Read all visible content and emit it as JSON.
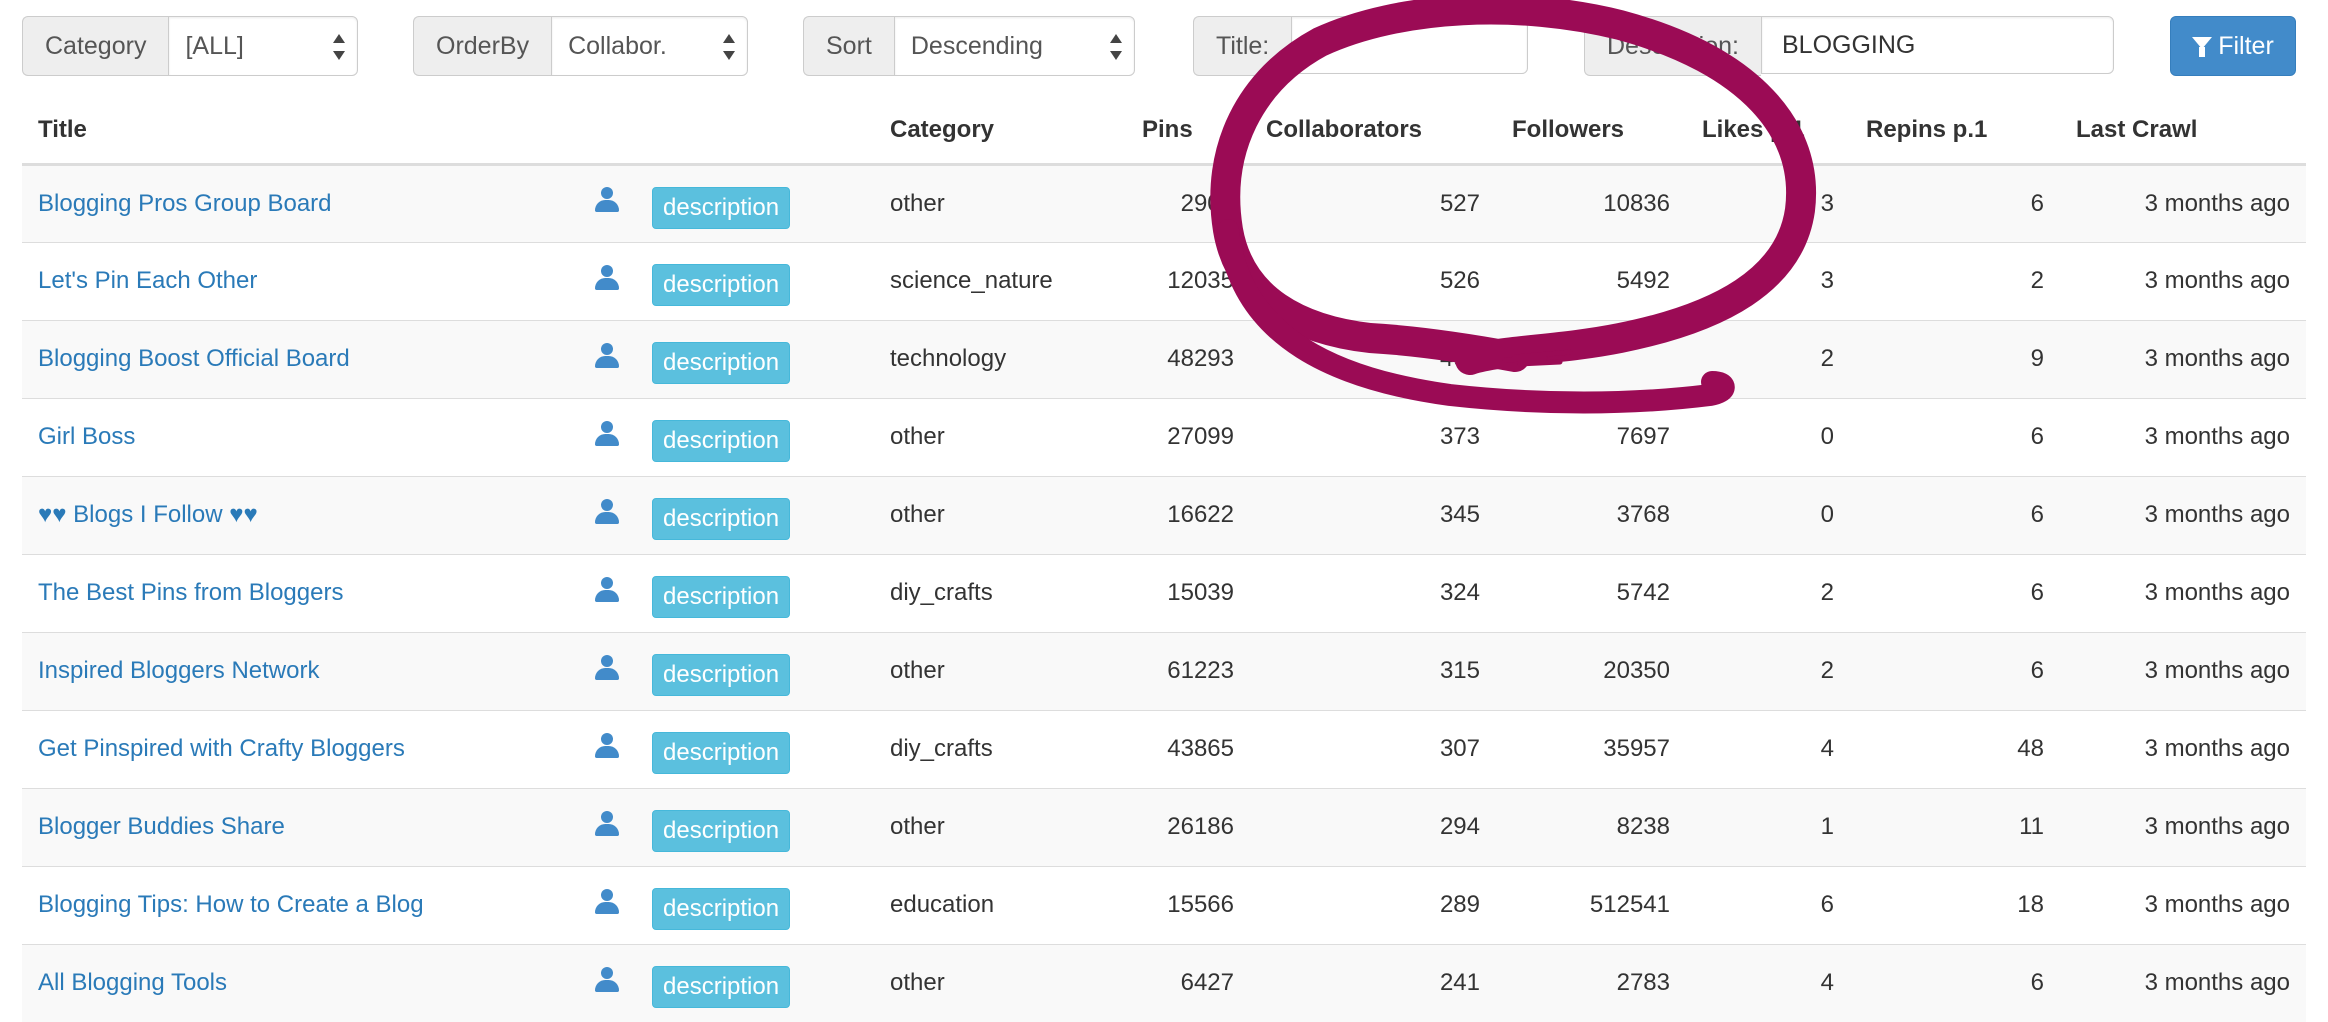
{
  "filters": {
    "category": {
      "label": "Category",
      "value": "[ALL]"
    },
    "orderby": {
      "label": "OrderBy",
      "value": "Collabor."
    },
    "sort": {
      "label": "Sort",
      "value": "Descending"
    },
    "title": {
      "label": "Title:",
      "value": ""
    },
    "description": {
      "label": "Description:",
      "value": "BLOGGING"
    },
    "filter_button": "Filter"
  },
  "table": {
    "headers": {
      "title": "Title",
      "category": "Category",
      "pins": "Pins",
      "collaborators": "Collaborators",
      "followers": "Followers",
      "likes": "Likes p.1",
      "repins": "Repins p.1",
      "last_crawl": "Last Crawl"
    },
    "description_label": "description",
    "rows": [
      {
        "title": "Blogging Pros Group Board",
        "category": "other",
        "pins": "2900",
        "collaborators": "527",
        "followers": "10836",
        "likes": "3",
        "repins": "6",
        "last_crawl": "3 months ago"
      },
      {
        "title": "Let's Pin Each Other",
        "category": "science_nature",
        "pins": "12035",
        "collaborators": "526",
        "followers": "5492",
        "likes": "3",
        "repins": "2",
        "last_crawl": "3 months ago"
      },
      {
        "title": "Blogging Boost Official Board",
        "category": "technology",
        "pins": "48293",
        "collaborators": "495",
        "followers": "",
        "likes": "2",
        "repins": "9",
        "last_crawl": "3 months ago"
      },
      {
        "title": "Girl Boss",
        "category": "other",
        "pins": "27099",
        "collaborators": "373",
        "followers": "7697",
        "likes": "0",
        "repins": "6",
        "last_crawl": "3 months ago"
      },
      {
        "title": "♥♥ Blogs I Follow ♥♥",
        "category": "other",
        "pins": "16622",
        "collaborators": "345",
        "followers": "3768",
        "likes": "0",
        "repins": "6",
        "last_crawl": "3 months ago"
      },
      {
        "title": "The Best Pins from Bloggers",
        "category": "diy_crafts",
        "pins": "15039",
        "collaborators": "324",
        "followers": "5742",
        "likes": "2",
        "repins": "6",
        "last_crawl": "3 months ago"
      },
      {
        "title": "Inspired Bloggers Network",
        "category": "other",
        "pins": "61223",
        "collaborators": "315",
        "followers": "20350",
        "likes": "2",
        "repins": "6",
        "last_crawl": "3 months ago"
      },
      {
        "title": "Get Pinspired with Crafty Bloggers",
        "category": "diy_crafts",
        "pins": "43865",
        "collaborators": "307",
        "followers": "35957",
        "likes": "4",
        "repins": "48",
        "last_crawl": "3 months ago"
      },
      {
        "title": "Blogger Buddies Share",
        "category": "other",
        "pins": "26186",
        "collaborators": "294",
        "followers": "8238",
        "likes": "1",
        "repins": "11",
        "last_crawl": "3 months ago"
      },
      {
        "title": "Blogging Tips: How to Create a Blog",
        "category": "education",
        "pins": "15566",
        "collaborators": "289",
        "followers": "512541",
        "likes": "6",
        "repins": "18",
        "last_crawl": "3 months ago"
      },
      {
        "title": "All Blogging Tools",
        "category": "other",
        "pins": "6427",
        "collaborators": "241",
        "followers": "2783",
        "likes": "4",
        "repins": "6",
        "last_crawl": "3 months ago"
      }
    ]
  },
  "colors": {
    "link": "#2a7ab8",
    "primary_button": "#428bca",
    "info_button": "#5bc0de",
    "annotation": "#9b0b55"
  },
  "icons": {
    "user": "user-icon",
    "filter": "filter-icon",
    "select_arrows": "select-arrows-icon"
  }
}
